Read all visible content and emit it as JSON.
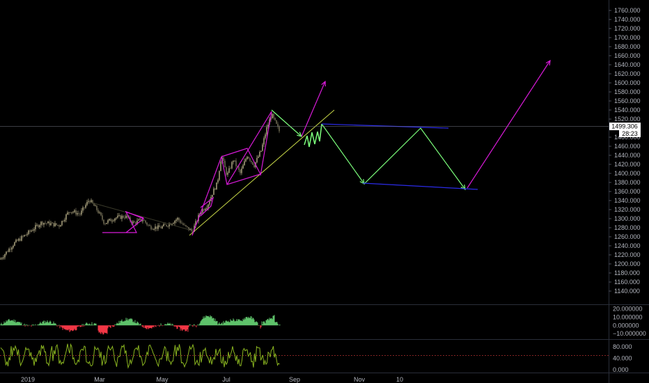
{
  "price_axis": {
    "labels": [
      "1760.000",
      "1740.000",
      "1720.000",
      "1700.000",
      "1680.000",
      "1660.000",
      "1640.000",
      "1620.000",
      "1600.000",
      "1580.000",
      "1560.000",
      "1540.000",
      "1520.000",
      "1500.000",
      "1480.000",
      "1460.000",
      "1440.000",
      "1420.000",
      "1400.000",
      "1380.000",
      "1360.000",
      "1340.000",
      "1320.000",
      "1300.000",
      "1280.000",
      "1260.000",
      "1240.000",
      "1220.000",
      "1200.000",
      "1180.000",
      "1160.000",
      "1140.000"
    ],
    "range": [
      1140,
      1760
    ]
  },
  "current_price": {
    "value": "1499.306",
    "countdown": "28:23"
  },
  "time_axis": {
    "labels": [
      "2019",
      "Mar",
      "May",
      "Jul",
      "Sep",
      "Nov",
      "10"
    ]
  },
  "oscillator1": {
    "labels": [
      "20.000000",
      "10.000000",
      "0.000000",
      "−10.000000"
    ],
    "range": [
      -14,
      22
    ]
  },
  "oscillator2": {
    "labels": [
      "80.000",
      "40.000",
      "0.000"
    ],
    "range": [
      -5,
      100
    ],
    "dashed_level": 50
  },
  "colors": {
    "background": "#000000",
    "candle_up": "#a39a78",
    "candle_down": "#6b6650",
    "pattern": "#d81ad8",
    "trendline": "#c8d848",
    "projection": "#7cff7c",
    "channel": "#2b2be8",
    "histogram_up": "#5ec26a",
    "histogram_down": "#f23645",
    "oscillator_line": "#8ab520",
    "dashed_level": "#b03030"
  }
}
